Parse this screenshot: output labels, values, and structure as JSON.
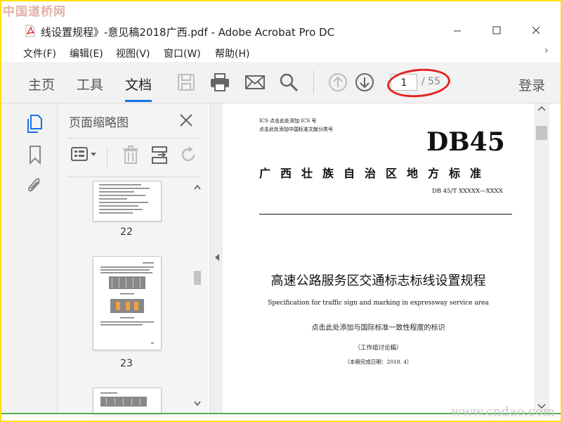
{
  "watermark": {
    "top": "中国道桥网",
    "bottom": "www.cndao.com"
  },
  "window": {
    "title": "线设置规程》-意见稿2018广西.pdf - Adobe Acrobat Pro DC"
  },
  "menu": {
    "items": [
      {
        "label": "文件(F)"
      },
      {
        "label": "编辑(E)"
      },
      {
        "label": "视图(V)"
      },
      {
        "label": "窗口(W)"
      },
      {
        "label": "帮助(H)"
      }
    ]
  },
  "toolbar": {
    "tabs": [
      {
        "label": "主页"
      },
      {
        "label": "工具"
      },
      {
        "label": "文档"
      }
    ],
    "active_tab": "文档",
    "current_page": "1",
    "total_pages": "/ 55",
    "login": "登录"
  },
  "thumbnails": {
    "title": "页面缩略图",
    "pages": [
      {
        "label": "22"
      },
      {
        "label": "23"
      }
    ]
  },
  "document": {
    "ics_line": "ICS 点击此处添加 ICS 号",
    "class_line": "点击此处添加中国标准文献分类号",
    "standard_code": "DB45",
    "authority": "广西壮族自治区地方标准",
    "doc_number": "DB 45/T XXXXX—XXXX",
    "title_cn": "高速公路服务区交通标志标线设置规程",
    "title_en": "Specification for traffic sign and marking in expressway service area",
    "consistency_note": "点击此处添加与国际标准一致性程度的标识",
    "draft_label": "（工作组讨论稿）",
    "draft_date": "（本稿完成日期：2018. 4）"
  },
  "colors": {
    "accent": "#1473e6",
    "annotation_red": "#e52222",
    "frame_yellow": "#ffe000",
    "icon_gray": "#666666",
    "icon_disabled": "#bdbdbd"
  }
}
